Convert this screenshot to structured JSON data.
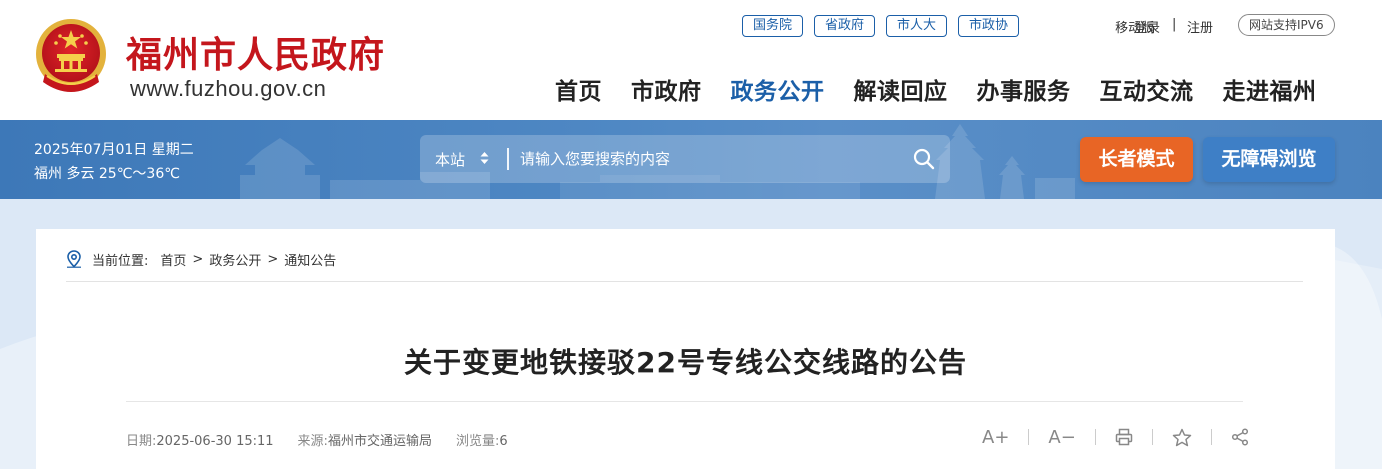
{
  "header": {
    "site_title": "福州市人民政府",
    "site_url": "www.fuzhou.gov.cn",
    "gov_links": [
      "国务院",
      "省政府",
      "市人大",
      "市政协"
    ],
    "mobile": "移动版",
    "login": "登录",
    "separator": "|",
    "register": "注册",
    "ipv6": "网站支持IPV6",
    "nav": [
      "首页",
      "市政府",
      "政务公开",
      "解读回应",
      "办事服务",
      "互动交流",
      "走进福州"
    ],
    "active_nav": "政务公开"
  },
  "banner": {
    "date": "2025年07月01日  星期二",
    "weather": "福州 多云 25℃～36℃",
    "search_scope": "本站",
    "search_placeholder": "请输入您要搜索的内容",
    "elder_mode": "长者模式",
    "accessibility": "无障碍浏览"
  },
  "breadcrumb": {
    "label": "当前位置:",
    "items": [
      "首页",
      "政务公开",
      "通知公告"
    ],
    "sep": ">"
  },
  "article": {
    "title": "关于变更地铁接驳22号专线公交线路的公告",
    "date_label": "日期:",
    "date": "2025-06-30 15:11",
    "source_label": "来源:",
    "source": "福州市交通运输局",
    "views_label": "浏览量:",
    "views": "6",
    "tools": {
      "font_up": "A+",
      "font_down": "A−"
    }
  },
  "colors": {
    "brand_red": "#c4161c",
    "nav_blue": "#1b5fa8",
    "banner_blue": "#4f88c4",
    "elder_orange": "#e86525",
    "access_blue": "#3e7fc6"
  }
}
